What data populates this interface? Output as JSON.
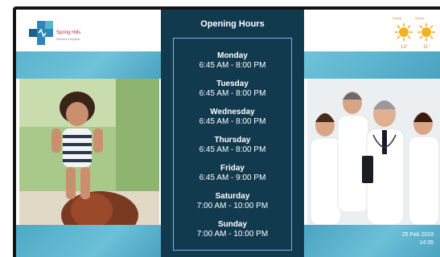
{
  "logo": {
    "name": "Spring Hills",
    "subtitle": "Medical Hospital"
  },
  "hours": {
    "title": "Opening Hours",
    "days": [
      {
        "day": "Monday",
        "hours": "6:45 AM - 8:00 PM"
      },
      {
        "day": "Tuesday",
        "hours": "6:45 AM - 8:00 PM"
      },
      {
        "day": "Wednesday",
        "hours": "6:45 AM - 8:00 PM"
      },
      {
        "day": "Thursday",
        "hours": "6:45 AM - 8:00 PM"
      },
      {
        "day": "Friday",
        "hours": "6:45 AM - 9:00 PM"
      },
      {
        "day": "Saturday",
        "hours": "7:00 AM - 10:00 PM"
      },
      {
        "day": "Sunday",
        "hours": "7:00 AM - 10:00 PM"
      }
    ]
  },
  "weather": [
    {
      "label": "Sunny",
      "temp": "13°",
      "icon": "sun-icon"
    },
    {
      "label": "Sunny",
      "temp": "11°",
      "icon": "sun-icon"
    }
  ],
  "datetime": {
    "date": "25 Feb 2019",
    "time": "14:35"
  },
  "colors": {
    "panel": "#123a4f",
    "accent": "#5ab3cd",
    "brand": "#c2264a"
  }
}
